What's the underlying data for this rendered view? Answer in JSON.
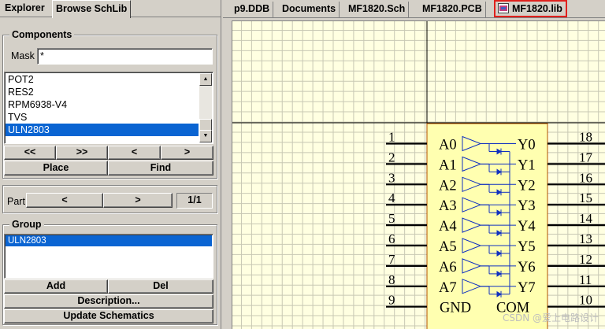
{
  "left_panel": {
    "tabs": [
      {
        "label": "Explorer",
        "active": false
      },
      {
        "label": "Browse SchLib",
        "active": true
      }
    ],
    "components": {
      "title": "Components",
      "mask_label": "Mask",
      "mask_value": "*",
      "items": [
        "POT2",
        "RES2",
        "RPM6938-V4",
        "TVS",
        "ULN2803"
      ],
      "selected": "ULN2803",
      "nav": {
        "first": "<<",
        "last": ">>",
        "prev": "<",
        "next": ">"
      },
      "place_label": "Place",
      "find_label": "Find"
    },
    "part": {
      "label": "Part",
      "prev": "<",
      "next": ">",
      "counter": "1/1"
    },
    "group": {
      "title": "Group",
      "items": [
        "ULN2803"
      ],
      "selected": "ULN2803",
      "add_label": "Add",
      "del_label": "Del",
      "description_label": "Description...",
      "update_label": "Update Schematics"
    }
  },
  "document_tabs": [
    {
      "label": "p9.DDB",
      "active": false
    },
    {
      "label": "Documents",
      "active": false
    },
    {
      "label": "MF1820.Sch",
      "active": false
    },
    {
      "label": "MF1820.PCB",
      "active": false
    },
    {
      "label": "MF1820.lib",
      "active": true,
      "highlight_color": "#e0201c"
    }
  ],
  "schematic": {
    "background_color": "#ffffe1",
    "grid_color": "#c8c8b4",
    "body_fill": "#ffffb0",
    "body_stroke": "#b05000",
    "symbol_color": "#1030c0",
    "left_pins": [
      {
        "number": "1",
        "name": "A0"
      },
      {
        "number": "2",
        "name": "A1"
      },
      {
        "number": "3",
        "name": "A2"
      },
      {
        "number": "4",
        "name": "A3"
      },
      {
        "number": "5",
        "name": "A4"
      },
      {
        "number": "6",
        "name": "A5"
      },
      {
        "number": "7",
        "name": "A6"
      },
      {
        "number": "8",
        "name": "A7"
      },
      {
        "number": "9",
        "name": "GND"
      }
    ],
    "right_pins": [
      {
        "number": "18",
        "name": "Y0"
      },
      {
        "number": "17",
        "name": "Y1"
      },
      {
        "number": "16",
        "name": "Y2"
      },
      {
        "number": "15",
        "name": "Y3"
      },
      {
        "number": "14",
        "name": "Y4"
      },
      {
        "number": "13",
        "name": "Y5"
      },
      {
        "number": "12",
        "name": "Y6"
      },
      {
        "number": "11",
        "name": "Y7"
      },
      {
        "number": "10",
        "name": "COM"
      }
    ]
  },
  "watermark": "CSDN @爱上电路设计"
}
